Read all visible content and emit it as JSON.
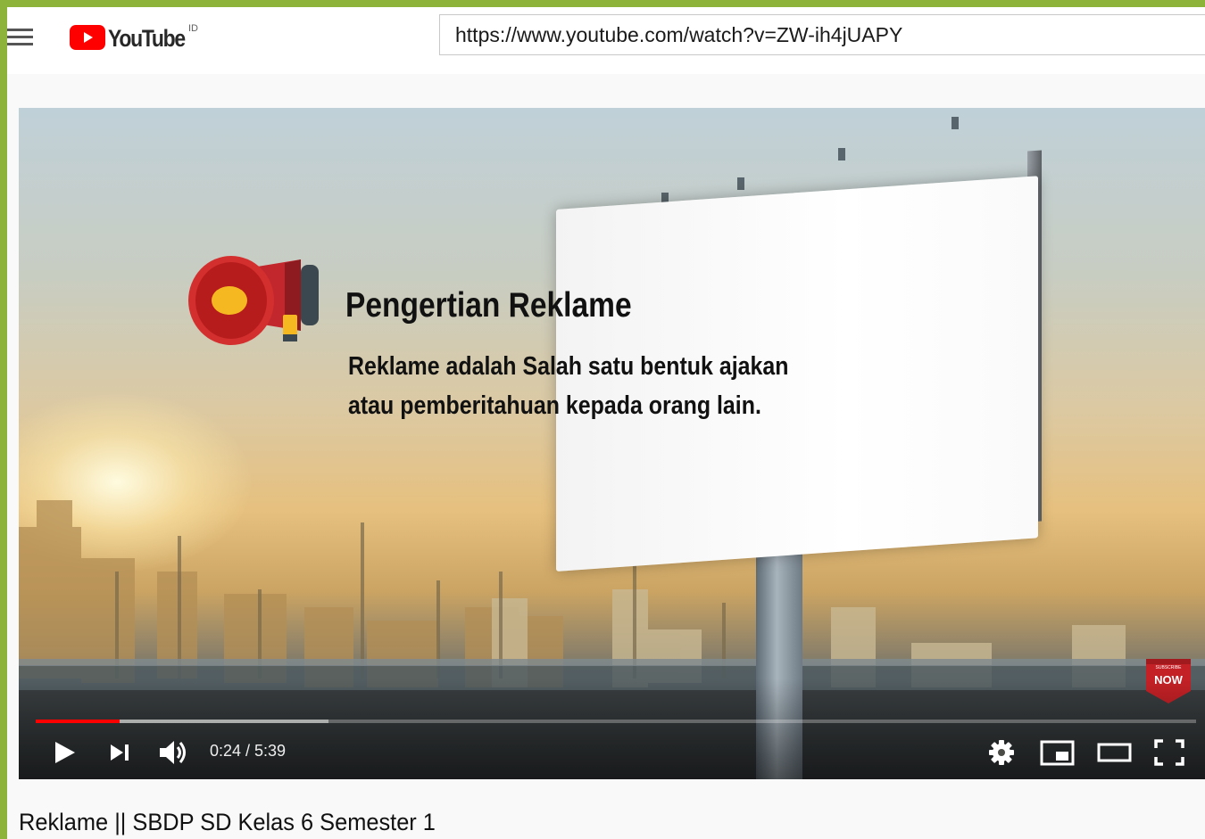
{
  "masthead": {
    "logo_text": "YouTube",
    "region": "ID",
    "url": "https://www.youtube.com/watch?v=ZW-ih4jUAPY"
  },
  "slide": {
    "title": "Pengertian Reklame",
    "line1": "Reklame adalah Salah satu bentuk ajakan",
    "line2": "atau pemberitahuan kepada orang lain."
  },
  "subscribe_badge": {
    "small": "SUBSCRIBE",
    "label": "NOW"
  },
  "player": {
    "time": "0:24 / 5:39",
    "progress_fraction": 0.072,
    "buffered_fraction": 0.252
  },
  "video": {
    "title": "Reklame || SBDP SD Kelas 6 Semester 1"
  },
  "colors": {
    "frame": "#8db33a",
    "youtube_red": "#ff0000",
    "progress": "#ff0000"
  },
  "icons": [
    "menu-icon",
    "youtube-logo-icon",
    "megaphone-icon",
    "play-icon",
    "next-icon",
    "volume-icon",
    "settings-icon",
    "miniplayer-icon",
    "theater-icon",
    "fullscreen-icon"
  ]
}
